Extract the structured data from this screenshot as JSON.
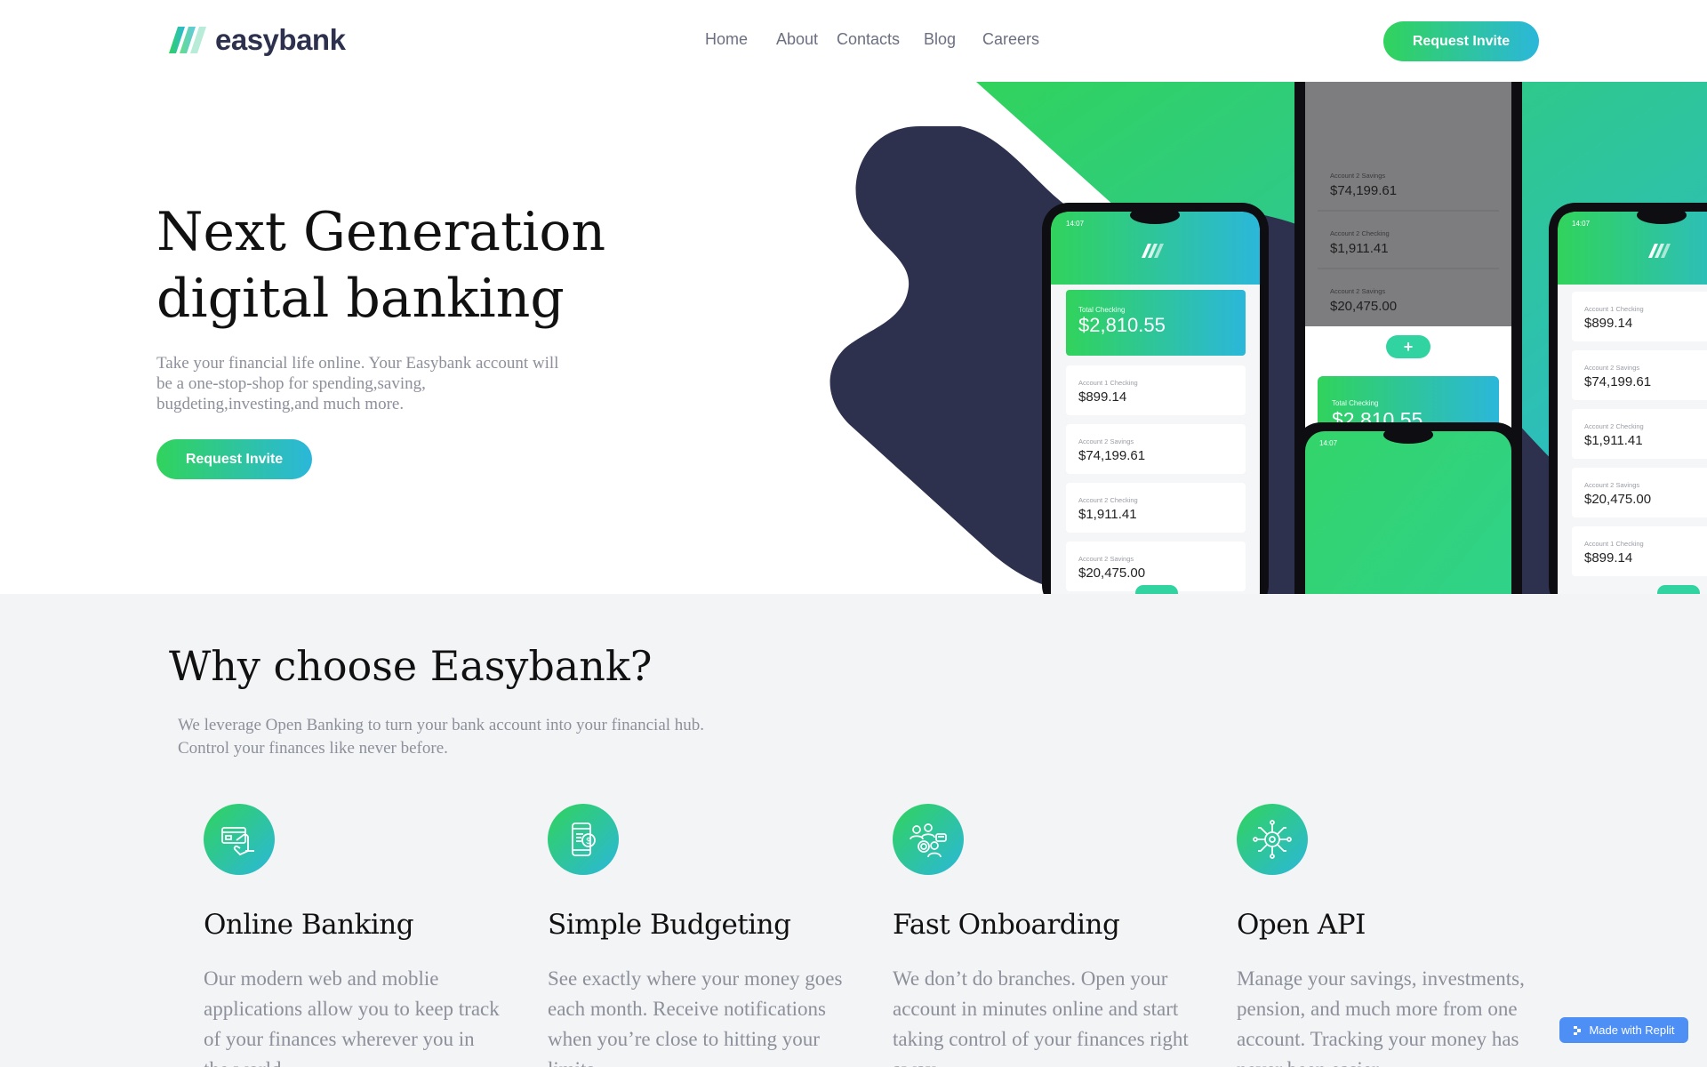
{
  "brand": {
    "name": "easybank"
  },
  "nav": {
    "links": [
      "Home",
      "About",
      "Contacts",
      "Blog",
      "Careers"
    ],
    "cta": "Request Invite"
  },
  "hero": {
    "title_line1": "Next Generation",
    "title_line2": "digital banking",
    "description": "Take your financial life online. Your Easybank account will be a one-stop-shop for spending,saving, bugdeting,investing,and much more.",
    "cta": "Request Invite",
    "phones": {
      "phone1": {
        "status_time": "14:07",
        "total_label": "Total Checking",
        "total_value": "$2,810.55",
        "accounts": [
          {
            "label": "Account 1 Checking",
            "value": "$899.14"
          },
          {
            "label": "Account 2 Savings",
            "value": "$74,199.61"
          },
          {
            "label": "Account 2 Checking",
            "value": "$1,911.41"
          },
          {
            "label": "Account 2 Savings",
            "value": "$20,475.00"
          }
        ]
      },
      "phone2": {
        "accounts": [
          {
            "label": "Account 2 Savings",
            "value": "$74,199.61"
          },
          {
            "label": "Account 2 Checking",
            "value": "$1,911.41"
          },
          {
            "label": "Account 2 Savings",
            "value": "$20,475.00"
          }
        ],
        "total_label": "Total Checking",
        "total_value": "$2,810.55"
      },
      "phone3": {
        "status_time": "14:07"
      },
      "phone4": {
        "status_time": "14:07",
        "accounts": [
          {
            "label": "Account 1 Checking",
            "value": "$899.14"
          },
          {
            "label": "Account 2 Savings",
            "value": "$74,199.61"
          },
          {
            "label": "Account 2 Checking",
            "value": "$1,911.41"
          },
          {
            "label": "Account 2 Savings",
            "value": "$20,475.00"
          },
          {
            "label": "Account 1 Checking",
            "value": "$899.14"
          }
        ]
      }
    }
  },
  "why": {
    "title": "Why choose Easybank?",
    "desc_line1": "We leverage Open Banking to turn your bank account into your financial hub.",
    "desc_line2": "Control your finances like never before.",
    "features": [
      {
        "icon": "online-banking-icon",
        "title": "Online Banking",
        "desc": "Our modern web and moblie applications allow you to keep track of your finances wherever you in the world."
      },
      {
        "icon": "budgeting-icon",
        "title": "Simple Budgeting",
        "desc": "See exactly where your money goes each month. Receive notifications when you’re close to hitting your limits."
      },
      {
        "icon": "onboarding-icon",
        "title": "Fast Onboarding",
        "desc": "We don’t do branches. Open your account in minutes online and start taking control of your finances right away."
      },
      {
        "icon": "api-icon",
        "title": "Open API",
        "desc": "Manage your savings, investments, pension, and much more from one account. Tracking your money has never been easier."
      }
    ]
  },
  "badge": {
    "label": "Made with Replit"
  },
  "colors": {
    "green": "#31d35c",
    "cyan": "#2bb7da",
    "navy": "#2d314d",
    "grey_bg": "#f3f4f6",
    "grey_text": "#8d8f9a"
  }
}
